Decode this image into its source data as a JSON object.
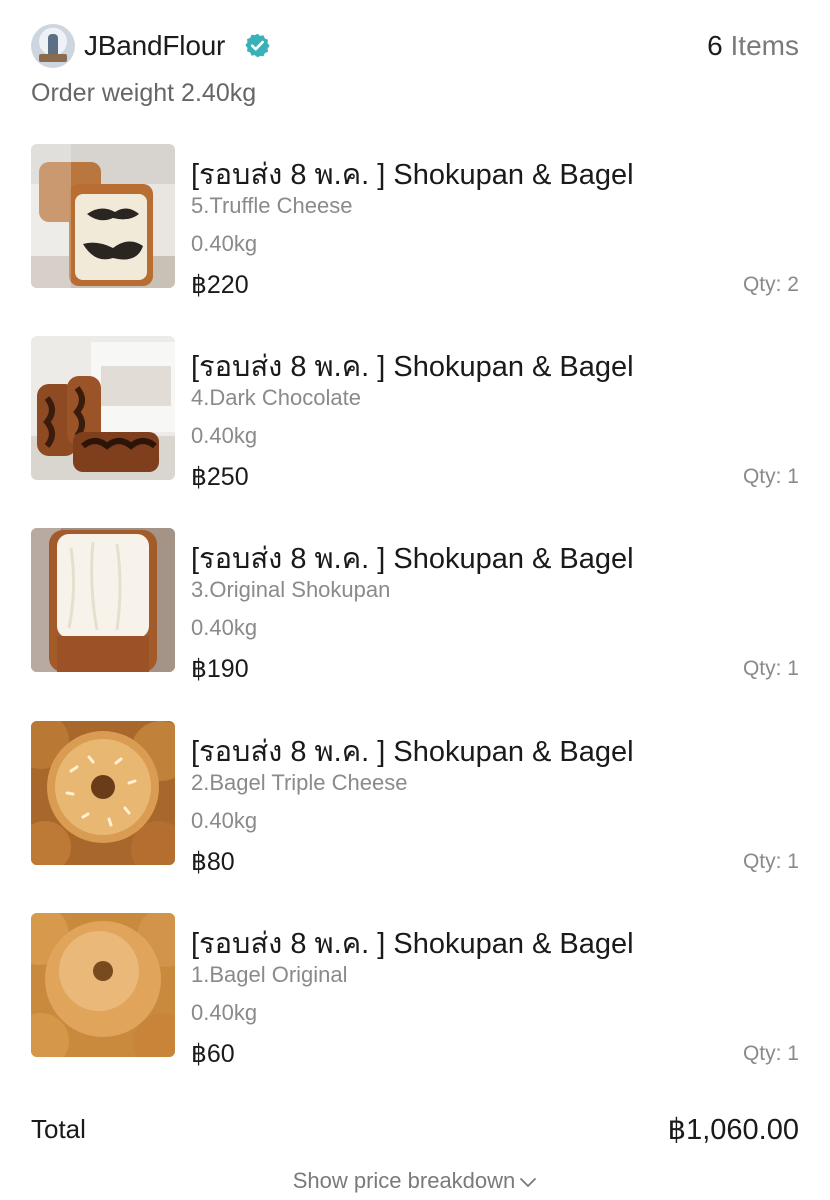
{
  "shop": {
    "name": "JBandFlour",
    "items_count": "6",
    "items_word": "Items",
    "order_weight": "Order weight 2.40kg"
  },
  "products": [
    {
      "title": "[รอบส่ง 8 พ.ค. ] Shokupan & Bagel",
      "variant": "5.Truffle Cheese",
      "weight": "0.40kg",
      "price": "฿220",
      "qty": "Qty: 2",
      "image": "truffle-cheese-shokupan-image"
    },
    {
      "title": "[รอบส่ง 8 พ.ค. ] Shokupan & Bagel",
      "variant": "4.Dark Chocolate",
      "weight": "0.40kg",
      "price": "฿250",
      "qty": "Qty: 1",
      "image": "dark-chocolate-shokupan-image"
    },
    {
      "title": "[รอบส่ง 8 พ.ค. ] Shokupan & Bagel",
      "variant": "3.Original Shokupan",
      "weight": "0.40kg",
      "price": "฿190",
      "qty": "Qty: 1",
      "image": "original-shokupan-image"
    },
    {
      "title": "[รอบส่ง 8 พ.ค. ] Shokupan & Bagel",
      "variant": "2.Bagel Triple Cheese",
      "weight": "0.40kg",
      "price": "฿80",
      "qty": "Qty: 1",
      "image": "bagel-triple-cheese-image"
    },
    {
      "title": "[รอบส่ง 8 พ.ค. ] Shokupan & Bagel",
      "variant": "1.Bagel Original",
      "weight": "0.40kg",
      "price": "฿60",
      "qty": "Qty: 1",
      "image": "bagel-original-image"
    }
  ],
  "summary": {
    "total_label": "Total",
    "total_value": "฿1,060.00",
    "breakdown_link": "Show price breakdown"
  },
  "icons": {
    "verified": "verified-badge-icon",
    "chevron": "chevron-down-icon"
  },
  "colors": {
    "verified_badge": "#3ab0b8",
    "muted_text": "#8a8a8a"
  }
}
